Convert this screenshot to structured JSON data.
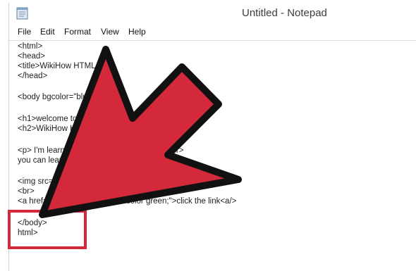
{
  "window": {
    "title": "Untitled - Notepad",
    "icon": "notepad-icon"
  },
  "menu": {
    "items": [
      {
        "label": "File"
      },
      {
        "label": "Edit"
      },
      {
        "label": "Format"
      },
      {
        "label": "View"
      },
      {
        "label": "Help"
      }
    ]
  },
  "editor": {
    "lines": [
      "<html>",
      "<head>",
      "<title>WikiHow HTML<",
      "</head>",
      "",
      "<body bgcolor=\"blu",
      "",
      "<h1>welcome to",
      "<h2>WikiHow H",
      "",
      "<p> I'm learnin                                    les! <br>",
      "you can learn",
      "",
      "<img src=\"                              00 height=\"200\"alt=\"WikiHow\">",
      "<br>",
      "<a href=\"           html\" swtyle=\"color green;\">click the link<a/>",
      "",
      "</body>",
      "html>"
    ]
  },
  "overlay": {
    "arrow_color": "#d4293a",
    "arrow_outline": "#111111",
    "box_color": "#d4293a"
  }
}
